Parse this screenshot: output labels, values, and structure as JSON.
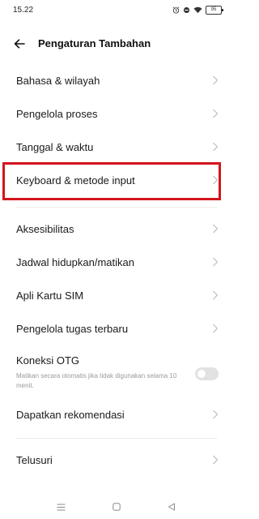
{
  "status": {
    "time": "15.22",
    "battery": "95",
    "icons": [
      "alarm-icon",
      "do-not-disturb-icon",
      "wifi-icon",
      "battery-icon"
    ]
  },
  "header": {
    "title": "Pengaturan Tambahan",
    "back_icon": "arrow-left-icon"
  },
  "menu": {
    "bahasa": "Bahasa & wilayah",
    "proses": "Pengelola proses",
    "tanggal": "Tanggal & waktu",
    "keyboard": "Keyboard & metode input",
    "aksesibilitas": "Aksesibilitas",
    "jadwal": "Jadwal hidupkan/matikan",
    "sim": "Apli Kartu SIM",
    "tugas": "Pengelola tugas terbaru",
    "otg_title": "Koneksi OTG",
    "otg_desc": "Matikan secara otomatis jika tidak digunakan selama 10 menit.",
    "otg_enabled": false,
    "rekomendasi": "Dapatkan rekomendasi",
    "telusuri": "Telusuri"
  },
  "colors": {
    "highlight": "#d4141c",
    "chevron": "#c4c4c4"
  },
  "nav": [
    "menu-icon",
    "home-icon",
    "back-icon"
  ]
}
